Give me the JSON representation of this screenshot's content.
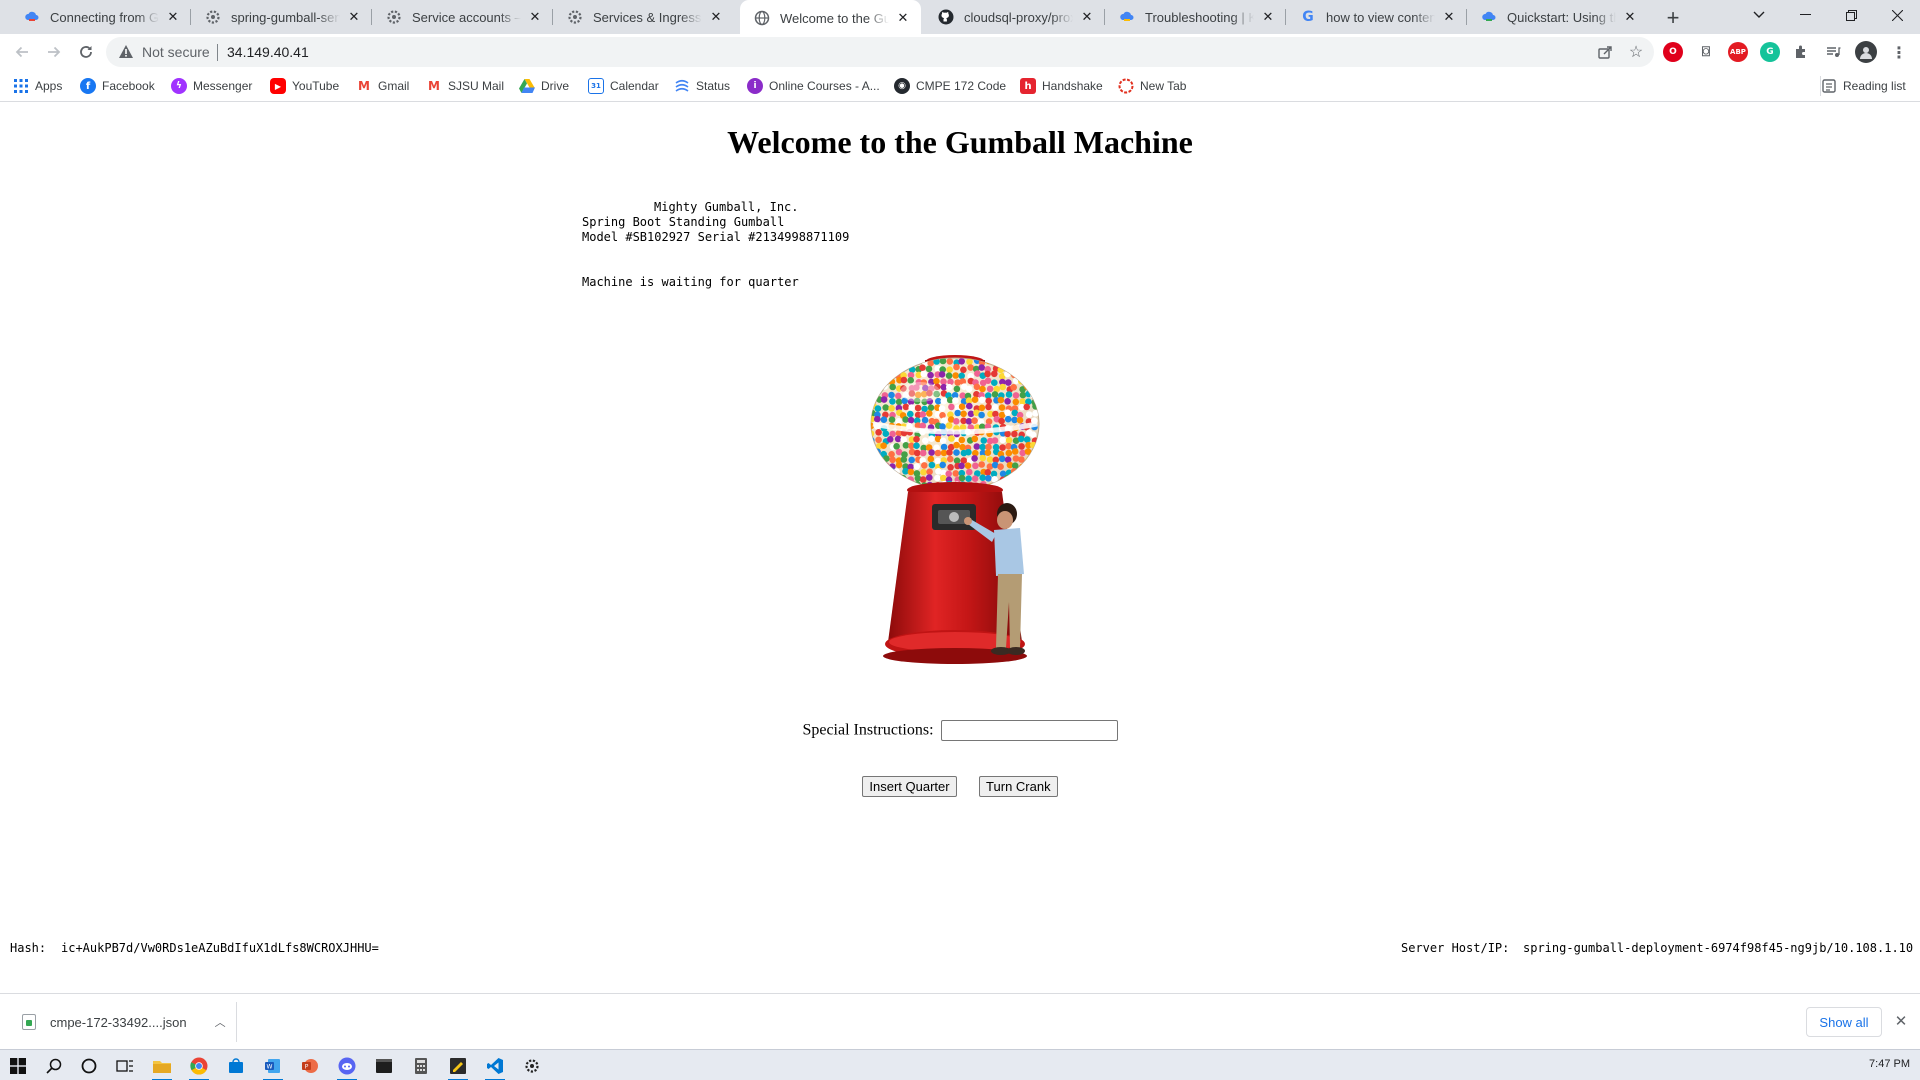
{
  "browser": {
    "tabs": [
      {
        "title": "Connecting from Google Kubernetes Engine",
        "icon": "gcloud-icon",
        "active": false
      },
      {
        "title": "spring-gumball-service",
        "icon": "gear-icon",
        "active": false
      },
      {
        "title": "Service accounts – IAM & Admin",
        "icon": "gear-icon",
        "active": false
      },
      {
        "title": "Services & Ingress – Kubernetes",
        "icon": "gear-icon",
        "active": false
      },
      {
        "title": "Welcome to the Gumball Machine",
        "icon": "globe-icon",
        "active": true
      },
      {
        "title": "cloudsql-proxy/proxy_configuration",
        "icon": "github-icon",
        "active": false
      },
      {
        "title": "Troubleshooting | Kubernetes",
        "icon": "gcloud-icon",
        "active": false
      },
      {
        "title": "how to view contents of json",
        "icon": "google-icon",
        "active": false
      },
      {
        "title": "Quickstart: Using the Cloud SQL",
        "icon": "gcloud-icon",
        "active": false
      }
    ],
    "security_label": "Not secure",
    "url": "34.149.40.41",
    "bookmarks": [
      {
        "label": "Apps",
        "icon": "apps-grid-icon"
      },
      {
        "label": "Facebook",
        "icon": "facebook-icon"
      },
      {
        "label": "Messenger",
        "icon": "messenger-icon"
      },
      {
        "label": "YouTube",
        "icon": "youtube-icon"
      },
      {
        "label": "Gmail",
        "icon": "gmail-icon"
      },
      {
        "label": "SJSU Mail",
        "icon": "gmail-icon"
      },
      {
        "label": "Drive",
        "icon": "drive-icon"
      },
      {
        "label": "Calendar",
        "icon": "calendar-icon"
      },
      {
        "label": "Status",
        "icon": "status-icon"
      },
      {
        "label": "Online Courses - A...",
        "icon": "courses-icon"
      },
      {
        "label": "CMPE 172 Code",
        "icon": "github-icon"
      },
      {
        "label": "Handshake",
        "icon": "handshake-icon"
      },
      {
        "label": "New Tab",
        "icon": "new-tab-icon"
      }
    ],
    "reading_list": "Reading list"
  },
  "page": {
    "title": "Welcome to the Gumball Machine",
    "machine_info": {
      "company": "Mighty Gumball, Inc.",
      "product": "Spring Boot Standing Gumball",
      "model_serial": "Model #SB102927 Serial #2134998871109"
    },
    "status": "Machine is waiting for quarter",
    "instructions_label": "Special Instructions:",
    "instructions_value": "",
    "insert_quarter_label": "Insert Quarter",
    "turn_crank_label": "Turn Crank",
    "hash_label": "Hash:",
    "hash_value": "ic+AukPB7d/Vw0RDs1eAZuBdIfuX1dLfs8WCROXJHHU=",
    "server_label": "Server Host/IP:",
    "server_value": "spring-gumball-deployment-6974f98f45-ng9jb/10.108.1.10"
  },
  "downloads": {
    "file_name": "cmpe-172-33492....json",
    "show_all_label": "Show all"
  },
  "taskbar": {
    "time": "7:47 PM"
  },
  "colors": {
    "tabstrip_bg": "#dee1e6",
    "gumball_red": "#d01818",
    "accent_blue": "#1a73e8"
  }
}
